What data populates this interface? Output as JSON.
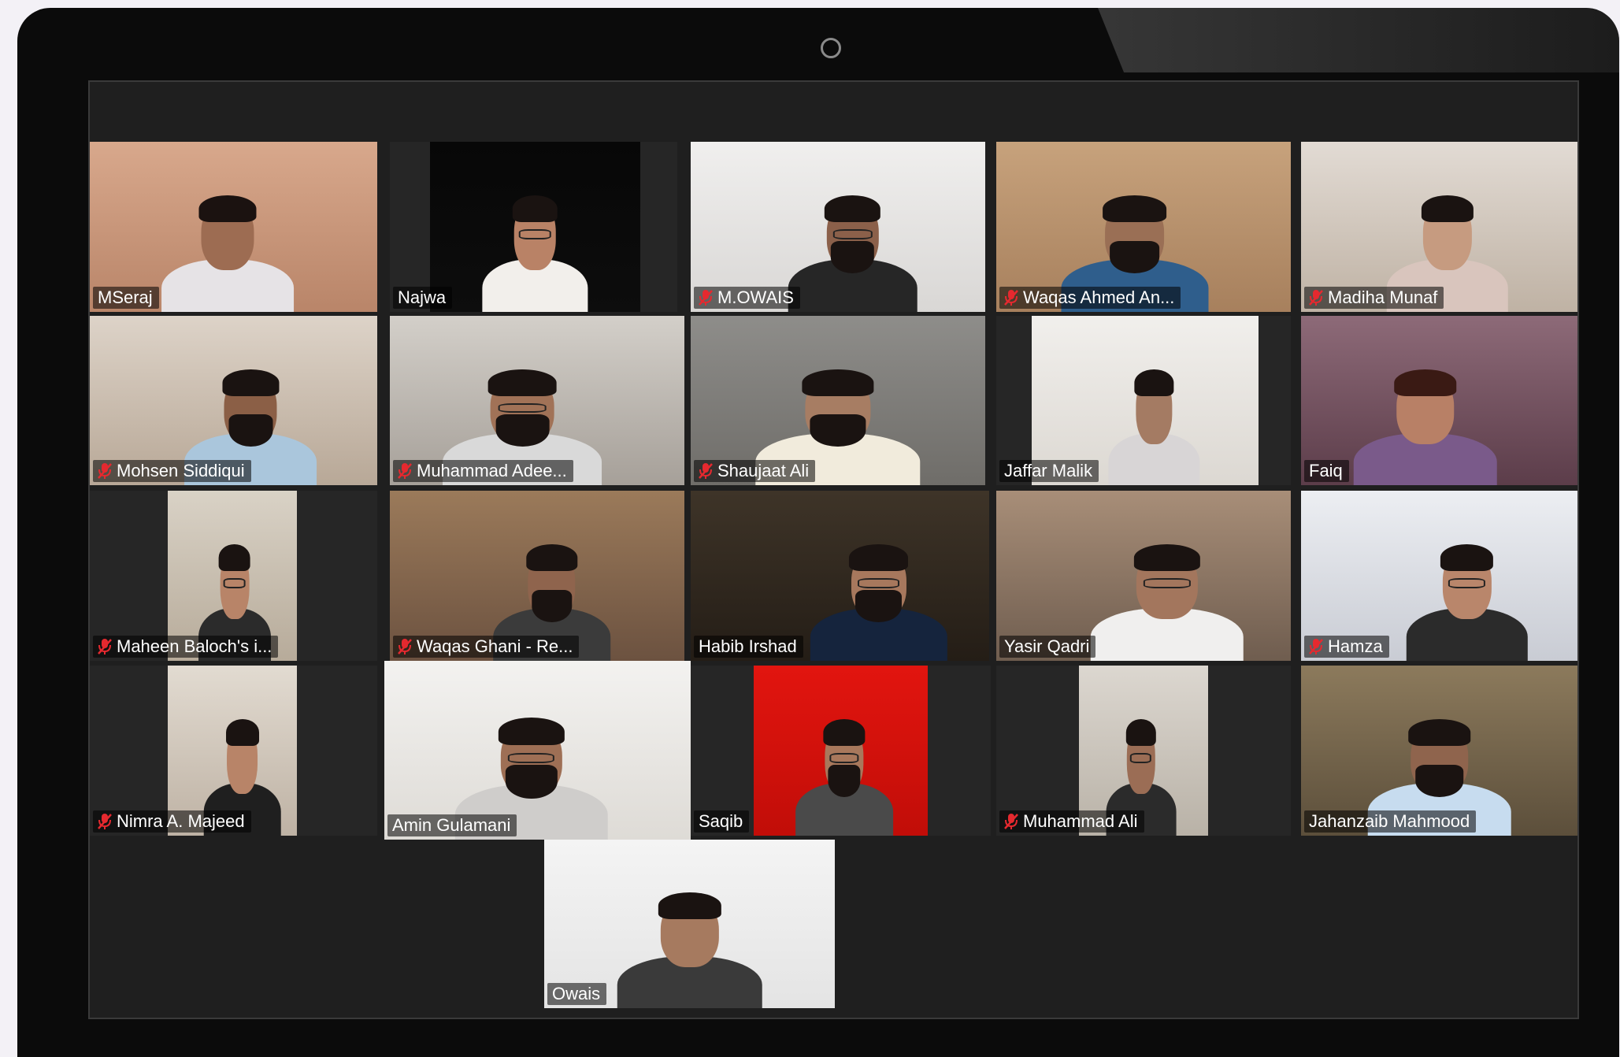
{
  "meeting": {
    "participants": [
      {
        "name": "MSeraj",
        "muted": false,
        "speaking": false,
        "colors": {
          "bg_top": "#d8a88c",
          "bg_bottom": "#b98569",
          "shirt": "#e6e3e6",
          "skin": "#9d6c52",
          "hair": "#1b1210"
        },
        "accessories": {
          "glasses": false,
          "beard": false
        },
        "camera_icon": "person-icon"
      },
      {
        "name": "Najwa",
        "muted": false,
        "speaking": false,
        "colors": {
          "bg_top": "#070707",
          "bg_bottom": "#0d0d0d",
          "shirt": "#f2efeb",
          "skin": "#b98266",
          "hair": "#1a1311"
        },
        "accessories": {
          "glasses": true,
          "beard": false
        },
        "camera_icon": "person-icon"
      },
      {
        "name": "M.OWAIS",
        "muted": true,
        "speaking": false,
        "colors": {
          "bg_top": "#f0efee",
          "bg_bottom": "#d9d7d5",
          "shirt": "#262626",
          "skin": "#8b604a",
          "hair": "#1a1311"
        },
        "accessories": {
          "glasses": true,
          "beard": true
        },
        "camera_icon": "person-icon"
      },
      {
        "name": "Waqas Ahmed An...",
        "muted": true,
        "speaking": false,
        "colors": {
          "bg_top": "#c7a27c",
          "bg_bottom": "#a7805d",
          "shirt": "#2f5e8c",
          "skin": "#9a6f55",
          "hair": "#1a1311"
        },
        "accessories": {
          "glasses": false,
          "beard": true
        },
        "camera_icon": "person-icon"
      },
      {
        "name": "Madiha Munaf",
        "muted": true,
        "speaking": false,
        "colors": {
          "bg_top": "#e2dbd4",
          "bg_bottom": "#bfb2a4",
          "shirt": "#d9c5bd",
          "skin": "#c69b80",
          "hair": "#1a1311"
        },
        "accessories": {
          "glasses": false,
          "beard": false
        },
        "camera_icon": "person-icon"
      },
      {
        "name": "Mohsen Siddiqui",
        "muted": true,
        "speaking": false,
        "colors": {
          "bg_top": "#ddd3c8",
          "bg_bottom": "#b8a897",
          "shirt": "#aac6dc",
          "skin": "#8b5f46",
          "hair": "#1a1311"
        },
        "accessories": {
          "glasses": false,
          "beard": true
        },
        "camera_icon": "person-icon"
      },
      {
        "name": "Muhammad Adee...",
        "muted": true,
        "speaking": false,
        "colors": {
          "bg_top": "#d3cfc9",
          "bg_bottom": "#a6a099",
          "shirt": "#d9d9d9",
          "skin": "#a17257",
          "hair": "#1a1311"
        },
        "accessories": {
          "glasses": true,
          "beard": true
        },
        "camera_icon": "person-icon"
      },
      {
        "name": "Shaujaat Ali",
        "muted": true,
        "speaking": false,
        "colors": {
          "bg_top": "#8e8d8a",
          "bg_bottom": "#6f6d69",
          "shirt": "#f1ebdc",
          "skin": "#a77d63",
          "hair": "#1a1311"
        },
        "accessories": {
          "glasses": false,
          "beard": true
        },
        "camera_icon": "person-icon"
      },
      {
        "name": "Jaffar Malik",
        "muted": false,
        "speaking": false,
        "colors": {
          "bg_top": "#f1efec",
          "bg_bottom": "#dcd8d2",
          "shirt": "#d8d5d6",
          "skin": "#a47b63",
          "hair": "#1a1311"
        },
        "accessories": {
          "glasses": false,
          "beard": false
        },
        "camera_icon": "person-icon"
      },
      {
        "name": "Faiq",
        "muted": false,
        "speaking": false,
        "colors": {
          "bg_top": "#8d6a78",
          "bg_bottom": "#5c3d4a",
          "shirt": "#7a5a8a",
          "skin": "#b88066",
          "hair": "#3a1a14"
        },
        "accessories": {
          "glasses": false,
          "beard": false
        },
        "camera_icon": "person-icon"
      },
      {
        "name": "Maheen Baloch's i...",
        "muted": true,
        "speaking": false,
        "colors": {
          "bg_top": "#d9d2c6",
          "bg_bottom": "#b7ab9a",
          "shirt": "#2b2b2b",
          "skin": "#b88468",
          "hair": "#1a1311"
        },
        "accessories": {
          "glasses": true,
          "beard": false
        },
        "camera_icon": "person-icon"
      },
      {
        "name": "Waqas Ghani - Re...",
        "muted": true,
        "speaking": false,
        "colors": {
          "bg_top": "#9b7a5a",
          "bg_bottom": "#6c5240",
          "shirt": "#3b3b3b",
          "skin": "#8f644d",
          "hair": "#1a1311"
        },
        "accessories": {
          "glasses": false,
          "beard": true
        },
        "camera_icon": "person-icon"
      },
      {
        "name": "Habib Irshad",
        "muted": false,
        "speaking": false,
        "colors": {
          "bg_top": "#3e3428",
          "bg_bottom": "#241d16",
          "shirt": "#15243d",
          "skin": "#a7785d",
          "hair": "#1a1311"
        },
        "accessories": {
          "glasses": true,
          "beard": true
        },
        "camera_icon": "person-icon"
      },
      {
        "name": "Yasir Qadri",
        "muted": false,
        "speaking": false,
        "colors": {
          "bg_top": "#a88e78",
          "bg_bottom": "#6f5d4f",
          "shirt": "#f0efee",
          "skin": "#a3765d",
          "hair": "#1a1311"
        },
        "accessories": {
          "glasses": true,
          "beard": false
        },
        "camera_icon": "person-icon"
      },
      {
        "name": "Hamza",
        "muted": true,
        "speaking": false,
        "colors": {
          "bg_top": "#eceef2",
          "bg_bottom": "#c9ccd4",
          "shirt": "#2b2b2b",
          "skin": "#b9866b",
          "hair": "#1a1311"
        },
        "accessories": {
          "glasses": true,
          "beard": false
        },
        "camera_icon": "person-icon"
      },
      {
        "name": "Nimra A. Majeed",
        "muted": true,
        "speaking": false,
        "colors": {
          "bg_top": "#e2dbd1",
          "bg_bottom": "#beb2a4",
          "shirt": "#1f1f1f",
          "skin": "#b88468",
          "hair": "#1a1311"
        },
        "accessories": {
          "glasses": false,
          "beard": false
        },
        "camera_icon": "person-icon"
      },
      {
        "name": "Amin Gulamani",
        "muted": false,
        "speaking": true,
        "colors": {
          "bg_top": "#f3f2f0",
          "bg_bottom": "#dedbd6",
          "shirt": "#cfcdcb",
          "skin": "#9e6f55",
          "hair": "#1a1311"
        },
        "accessories": {
          "glasses": true,
          "beard": true
        },
        "camera_icon": "person-icon"
      },
      {
        "name": "Saqib",
        "muted": false,
        "speaking": false,
        "colors": {
          "bg_top": "#e2150f",
          "bg_bottom": "#c10d08",
          "shirt": "#4a4a4a",
          "skin": "#a8785c",
          "hair": "#1a1311"
        },
        "accessories": {
          "glasses": true,
          "beard": true
        },
        "camera_icon": "person-icon"
      },
      {
        "name": "Muhammad Ali",
        "muted": true,
        "speaking": false,
        "colors": {
          "bg_top": "#dcd7d0",
          "bg_bottom": "#b9b2a7",
          "shirt": "#2b2b2b",
          "skin": "#9b6d55",
          "hair": "#1a1311"
        },
        "accessories": {
          "glasses": true,
          "beard": false
        },
        "camera_icon": "person-icon"
      },
      {
        "name": "Jahanzaib Mahmood",
        "muted": false,
        "speaking": false,
        "colors": {
          "bg_top": "#8c7a5c",
          "bg_bottom": "#5c4f3b",
          "shirt": "#c7dcef",
          "skin": "#8f644d",
          "hair": "#1a1311"
        },
        "accessories": {
          "glasses": false,
          "beard": true
        },
        "camera_icon": "person-icon"
      },
      {
        "name": "Owais",
        "muted": false,
        "speaking": false,
        "colors": {
          "bg_top": "#f4f4f4",
          "bg_bottom": "#e4e4e4",
          "shirt": "#3a3a3a",
          "skin": "#a67a5f",
          "hair": "#1a1311"
        },
        "accessories": {
          "glasses": false,
          "beard": false
        },
        "camera_icon": "person-icon"
      }
    ]
  },
  "colors": {
    "speaker_highlight": "#d7e66a",
    "muted_icon": "#e5292f",
    "name_text": "#ffffff"
  }
}
